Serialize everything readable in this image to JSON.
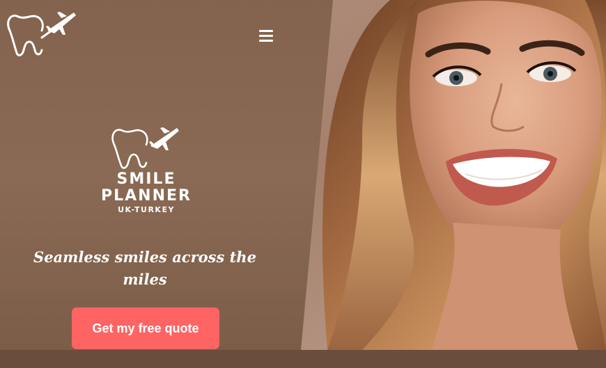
{
  "header": {
    "logo_icon": "tooth-plane-icon",
    "menu_icon": "hamburger-menu-icon"
  },
  "brand": {
    "icon": "tooth-plane-icon",
    "line1": "SMILE",
    "line2": "PLANNER",
    "subline": "UK-TURKEY"
  },
  "hero": {
    "tagline": "Seamless smiles across the miles",
    "cta_label": "Get my free quote",
    "photo": "smiling-woman-portrait"
  },
  "colors": {
    "background": "#83634d",
    "accent": "#ff6464",
    "text": "#ffffff"
  }
}
